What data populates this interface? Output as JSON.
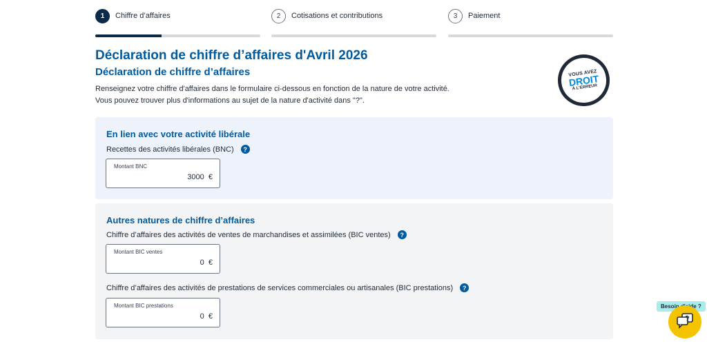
{
  "stepper": {
    "steps": [
      {
        "num": "1",
        "label": "Chiffre d’affaires",
        "progress": 0.4
      },
      {
        "num": "2",
        "label": "Cotisations et contributions",
        "progress": 0
      },
      {
        "num": "3",
        "label": "Paiement",
        "progress": 0
      }
    ]
  },
  "page": {
    "title": "Déclaration de chiffre d’affaires d'Avril 2026",
    "subtitle": "Déclaration de chiffre d’affaires",
    "intro_line1": "Renseignez votre chiffre d'affaires dans le formulaire ci-dessous en fonction de la nature de votre activité.",
    "intro_line2": "Vous pouvez trouver plus d'informations au sujet de la nature d'activité dans \"?\"."
  },
  "badge": {
    "line1": "VOUS AVEZ",
    "line2": "DROIT",
    "line3": "À L'ERREUR"
  },
  "liberal": {
    "title": "En lien avec votre activité libérale",
    "field_label": "Recettes des activités libérales (BNC)",
    "input_placeholder": "Montant BNC",
    "input_value": "3000",
    "currency": "€"
  },
  "autres": {
    "title": "Autres natures de chiffre d’affaires",
    "ventes_label": "Chiffre d’affaires des activités de ventes de marchandises et assimilées (BIC ventes)",
    "ventes_placeholder": "Montant BIC ventes",
    "ventes_value": "0",
    "prestations_label": "Chiffre d’affaires des activités de prestations de services commerciales ou artisanales (BIC prestations)",
    "prestations_placeholder": "Montant BIC prestations",
    "prestations_value": "0",
    "currency": "€"
  },
  "help": {
    "tag": "Besoin d'aide ?",
    "icon": "chat-help-icon"
  },
  "help_glyph": "?",
  "colors": {
    "primary": "#005a9e",
    "dark": "#0b2a4a",
    "help_button": "#f5c400"
  }
}
